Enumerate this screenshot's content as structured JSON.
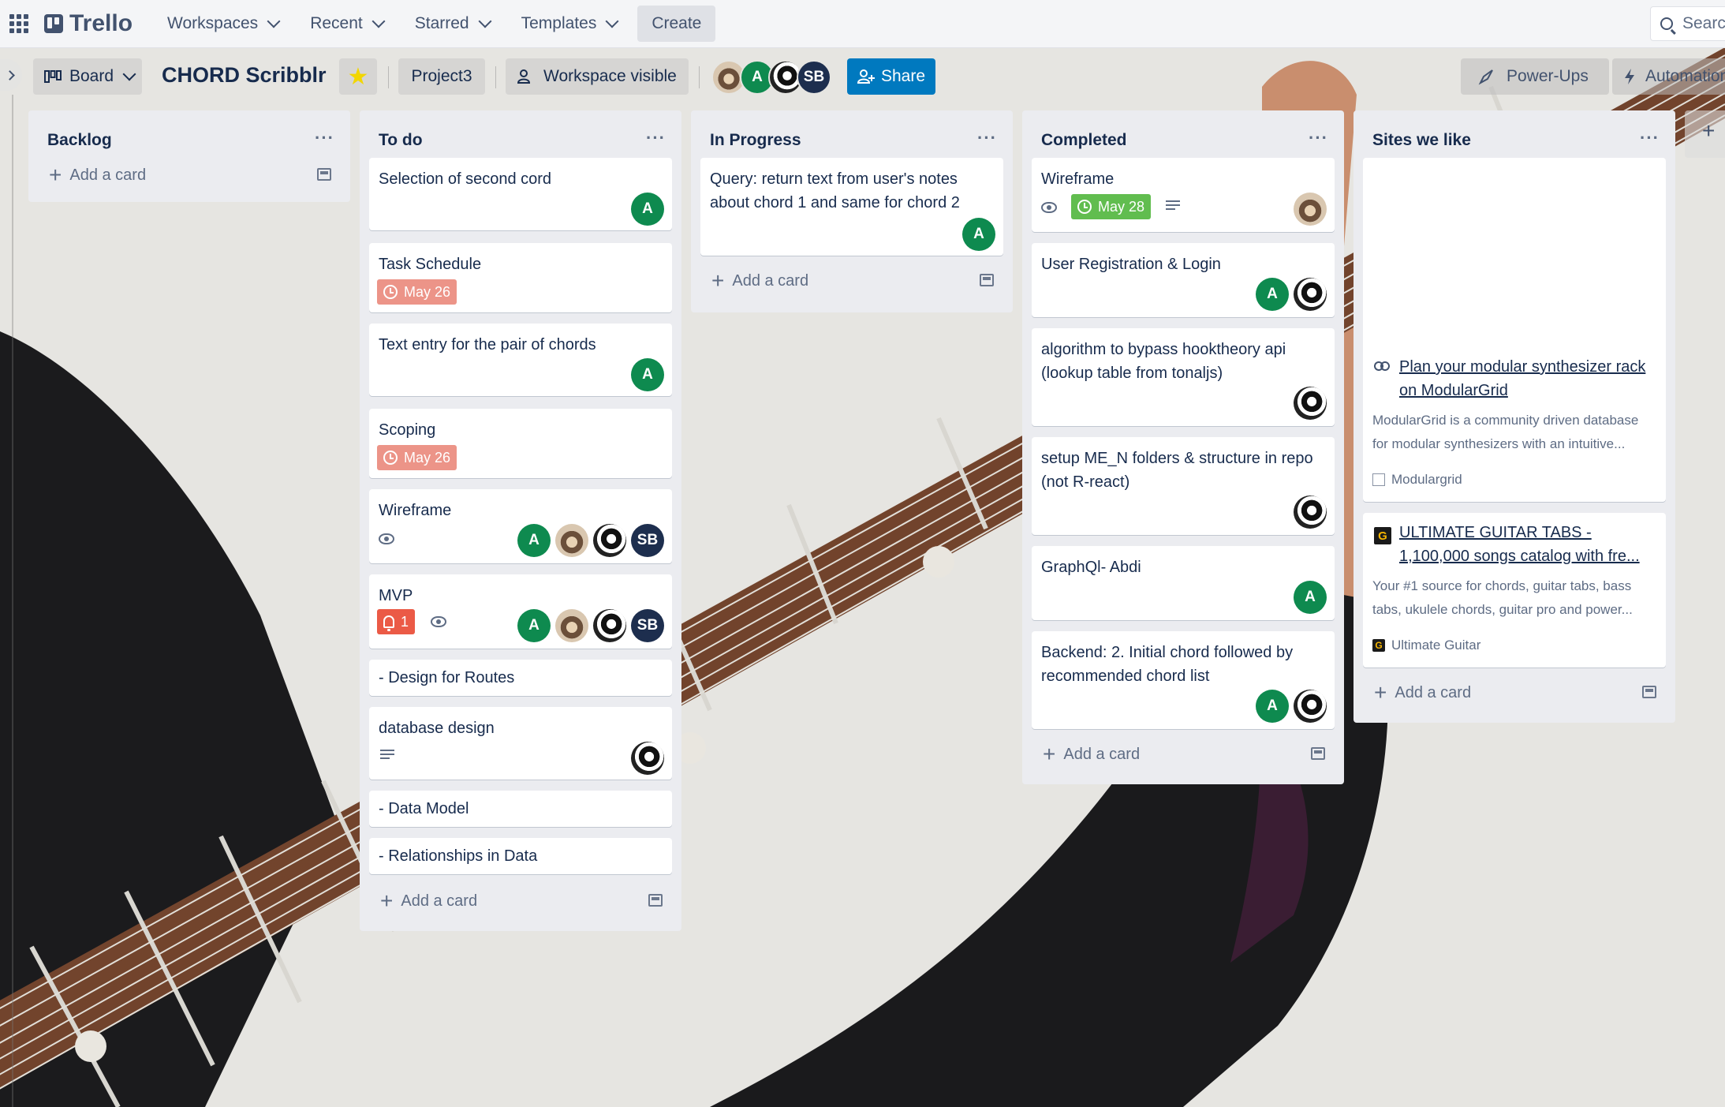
{
  "topnav": {
    "logo": "Trello",
    "workspaces": "Workspaces",
    "recent": "Recent",
    "starred": "Starred",
    "templates": "Templates",
    "create": "Create",
    "search_placeholder": "Search"
  },
  "board_header": {
    "view": "Board",
    "title": "CHORD Scribblr",
    "workspace_name": "Project3",
    "visibility": "Workspace visible",
    "share": "Share",
    "member_initials": [
      "A",
      "SB"
    ],
    "power_ups": "Power-Ups",
    "automation": "Automation"
  },
  "add_card": "Add a card",
  "lists": [
    {
      "title": "Backlog",
      "cards": []
    },
    {
      "title": "To do",
      "cards": [
        {
          "title": "Selection of second cord",
          "members": [
            "A"
          ]
        },
        {
          "title": "Task Schedule",
          "due": "May 26"
        },
        {
          "title": "Text entry for the pair of chords",
          "members": [
            "A"
          ]
        },
        {
          "title": "Scoping",
          "due": "May 26"
        },
        {
          "title": "Wireframe",
          "watching": true,
          "members": [
            "A",
            "photo",
            "photo",
            "SB"
          ]
        },
        {
          "title": "MVP",
          "notifications": "1",
          "watching": true,
          "members": [
            "A",
            "photo",
            "photo",
            "SB"
          ]
        },
        {
          "title": "- Design for Routes"
        },
        {
          "title": "database design",
          "has_description": true,
          "members": [
            "photo"
          ]
        },
        {
          "title": "- Data Model"
        },
        {
          "title": "- Relationships in Data"
        }
      ]
    },
    {
      "title": "In Progress",
      "cards": [
        {
          "title": "Query: return text from user's notes about chord 1 and same for chord 2",
          "members": [
            "A"
          ]
        }
      ]
    },
    {
      "title": "Completed",
      "cards": [
        {
          "title": "Wireframe",
          "watching": true,
          "due": "May 28",
          "has_description": true,
          "members": [
            "photo"
          ]
        },
        {
          "title": "User Registration & Login",
          "members": [
            "A",
            "photo"
          ]
        },
        {
          "title": "algorithm to bypass hooktheory api (lookup table from tonaljs)",
          "members": [
            "photo"
          ]
        },
        {
          "title": "setup ME_N folders & structure in repo (not R-react)",
          "members": [
            "photo"
          ]
        },
        {
          "title": "GraphQl- Abdi",
          "members": [
            "A"
          ]
        },
        {
          "title": "Backend: 2. Initial chord followed by recommended chord list",
          "members": [
            "A",
            "photo"
          ]
        }
      ]
    },
    {
      "title": "Sites we like",
      "cards": [
        {
          "title": "Plan your modular synthesizer rack on ModularGrid",
          "description": "ModularGrid is a community driven database for modular synthesizers with an intuitive...",
          "source": "Modulargrid"
        },
        {
          "title": "ULTIMATE GUITAR TABS - 1,100,000 songs catalog with fre...",
          "description": "Your #1 source for chords, guitar tabs, bass tabs, ukulele chords, guitar pro and power...",
          "source": "Ultimate Guitar"
        }
      ]
    }
  ],
  "colors": {
    "due_overdue": "#ec9488",
    "due_complete": "#61bd4f",
    "share_button": "#0079bf",
    "member_a": "#0e8a4f",
    "member_sb": "#1d2e4e"
  }
}
